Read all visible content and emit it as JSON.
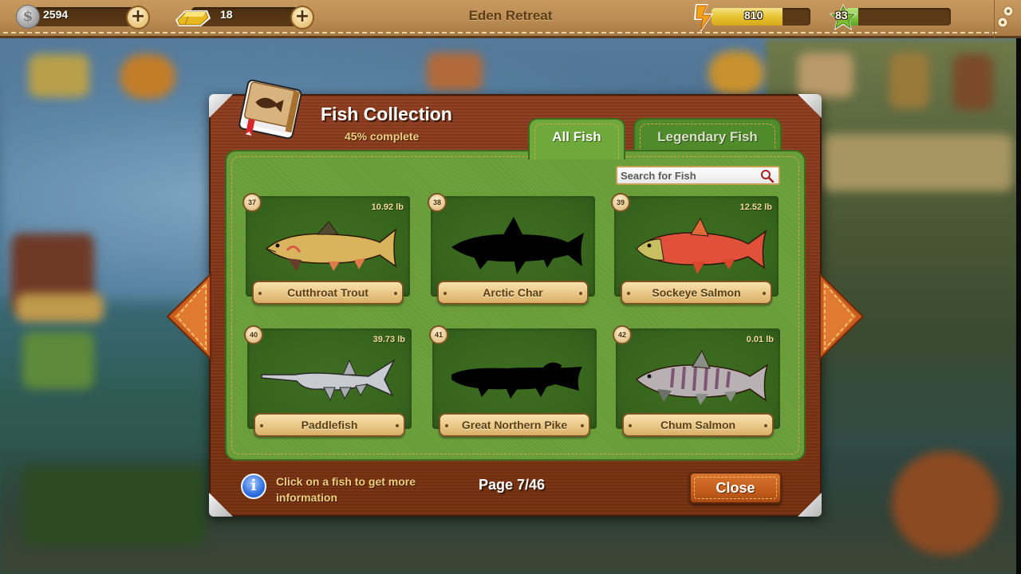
{
  "topbar": {
    "coins": "2594",
    "gold": "18",
    "location": "Eden Retreat",
    "energy": {
      "value": "810",
      "fill_fraction": 0.72
    },
    "level": {
      "value": "83",
      "xp_fill_fraction": 0.12
    },
    "icons": {
      "coin": "silver-coin-icon",
      "gold": "gold-bars-icon",
      "energy": "lightning-bolt-icon",
      "level": "star-icon",
      "settings": "gears-icon",
      "add": "plus-icon"
    }
  },
  "dialog": {
    "title": "Fish Collection",
    "progress_text": "45% complete",
    "progress_percent": 45,
    "tabs": [
      {
        "label": "All Fish",
        "active": true
      },
      {
        "label": "Legendary Fish",
        "active": false
      }
    ],
    "search": {
      "placeholder": "Search for Fish",
      "value": ""
    },
    "fish": [
      {
        "number": "37",
        "name": "Cutthroat Trout",
        "weight": "10.92 lb",
        "caught": true
      },
      {
        "number": "38",
        "name": "Arctic Char",
        "weight": "",
        "caught": false
      },
      {
        "number": "39",
        "name": "Sockeye Salmon",
        "weight": "12.52 lb",
        "caught": true
      },
      {
        "number": "40",
        "name": "Paddlefish",
        "weight": "39.73 lb",
        "caught": true
      },
      {
        "number": "41",
        "name": "Great Northern Pike",
        "weight": "",
        "caught": false
      },
      {
        "number": "42",
        "name": "Chum Salmon",
        "weight": "0.01 lb",
        "caught": true
      }
    ],
    "hint": "Click on a fish to get more information",
    "page": "Page 7/46",
    "close_label": "Close"
  },
  "colors": {
    "wood": "#7e3416",
    "felt": "#6aa13a",
    "card": "#36641c",
    "leather": "#b98a52",
    "accent_orange": "#c35d1c",
    "gold_text": "#f0cf7c"
  }
}
